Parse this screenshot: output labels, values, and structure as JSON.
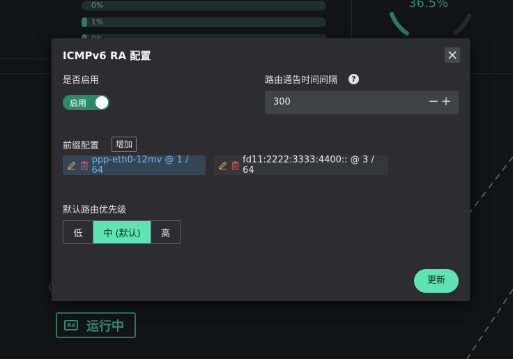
{
  "background": {
    "progress_rows": [
      {
        "label": "0%",
        "fill": 0
      },
      {
        "label": "1%",
        "fill": 0.01
      },
      {
        "label": "0%",
        "fill": 0
      }
    ],
    "gauge_value": "36.5%",
    "status_badge": {
      "icon": "ad-icon",
      "label": "运行中"
    }
  },
  "modal": {
    "title": "ICMPv6 RA 配置",
    "enable": {
      "label": "是否启用",
      "toggle_text": "启用",
      "on": true
    },
    "interval": {
      "label": "路由通告时间间隔",
      "help_icon": "question-circle-icon",
      "value": "300",
      "minus": "−",
      "plus": "+"
    },
    "prefix": {
      "label": "前缀配置",
      "add_label": "增加",
      "items": [
        {
          "text": "ppp-eth0-12mv @ 1 / 64",
          "edit_icon": "pencil-icon",
          "delete_icon": "trash-icon"
        },
        {
          "text": "fd11:2222:3333:4400:: @ 3 / 64",
          "edit_icon": "pencil-icon",
          "delete_icon": "trash-icon"
        }
      ]
    },
    "priority": {
      "label": "默认路由优先级",
      "options": [
        "低",
        "中 (默认)",
        "高"
      ],
      "selected": "中 (默认)"
    },
    "submit_label": "更新"
  },
  "colors": {
    "accent": "#5ee4b4",
    "toggle_on": "#2a8a6a",
    "modal_bg": "#2d2d31",
    "link_blue": "#75b5ec"
  }
}
